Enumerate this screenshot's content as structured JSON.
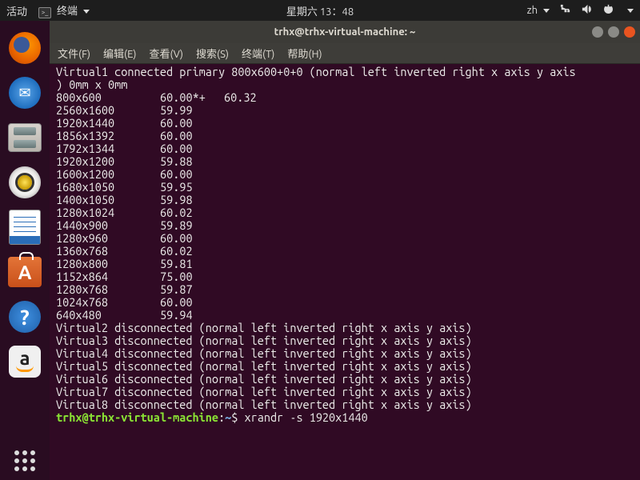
{
  "topbar": {
    "activities": "活动",
    "app_label": "终端",
    "clock": "星期六 13：48",
    "lang": "zh"
  },
  "dock": [
    {
      "name": "firefox",
      "label": "Firefox"
    },
    {
      "name": "thunderbird",
      "label": "Thunderbird"
    },
    {
      "name": "files",
      "label": "Files"
    },
    {
      "name": "rhythmbox",
      "label": "Rhythmbox"
    },
    {
      "name": "writer",
      "label": "LibreOffice Writer"
    },
    {
      "name": "software",
      "label": "Ubuntu Software"
    },
    {
      "name": "help",
      "label": "Help"
    },
    {
      "name": "amazon",
      "label": "Amazon"
    }
  ],
  "window": {
    "title": "trhx@trhx-virtual-machine: ~"
  },
  "menubar": {
    "file": "文件(F)",
    "edit": "编辑(E)",
    "view": "查看(V)",
    "search": "搜索(S)",
    "terminal": "终端(T)",
    "help": "帮助(H)"
  },
  "output": {
    "header": "Virtual1 connected primary 800x600+0+0 (normal left inverted right x axis y axis) 0mm x 0mm",
    "modes": [
      {
        "res": "800x600",
        "rate": "60.00*+",
        "extra": "60.32"
      },
      {
        "res": "2560x1600",
        "rate": "59.99",
        "extra": ""
      },
      {
        "res": "1920x1440",
        "rate": "60.00",
        "extra": ""
      },
      {
        "res": "1856x1392",
        "rate": "60.00",
        "extra": ""
      },
      {
        "res": "1792x1344",
        "rate": "60.00",
        "extra": ""
      },
      {
        "res": "1920x1200",
        "rate": "59.88",
        "extra": ""
      },
      {
        "res": "1600x1200",
        "rate": "60.00",
        "extra": ""
      },
      {
        "res": "1680x1050",
        "rate": "59.95",
        "extra": ""
      },
      {
        "res": "1400x1050",
        "rate": "59.98",
        "extra": ""
      },
      {
        "res": "1280x1024",
        "rate": "60.02",
        "extra": ""
      },
      {
        "res": "1440x900",
        "rate": "59.89",
        "extra": ""
      },
      {
        "res": "1280x960",
        "rate": "60.00",
        "extra": ""
      },
      {
        "res": "1360x768",
        "rate": "60.02",
        "extra": ""
      },
      {
        "res": "1280x800",
        "rate": "59.81",
        "extra": ""
      },
      {
        "res": "1152x864",
        "rate": "75.00",
        "extra": ""
      },
      {
        "res": "1280x768",
        "rate": "59.87",
        "extra": ""
      },
      {
        "res": "1024x768",
        "rate": "60.00",
        "extra": ""
      },
      {
        "res": "640x480",
        "rate": "59.94",
        "extra": ""
      }
    ],
    "disconnected": [
      "Virtual2 disconnected (normal left inverted right x axis y axis)",
      "Virtual3 disconnected (normal left inverted right x axis y axis)",
      "Virtual4 disconnected (normal left inverted right x axis y axis)",
      "Virtual5 disconnected (normal left inverted right x axis y axis)",
      "Virtual6 disconnected (normal left inverted right x axis y axis)",
      "Virtual7 disconnected (normal left inverted right x axis y axis)",
      "Virtual8 disconnected (normal left inverted right x axis y axis)"
    ],
    "prompt_user": "trhx@trhx-virtual-machine",
    "prompt_colon": ":",
    "prompt_path": "~",
    "prompt_dollar": "$",
    "command": " xrandr -s 1920x1440"
  }
}
